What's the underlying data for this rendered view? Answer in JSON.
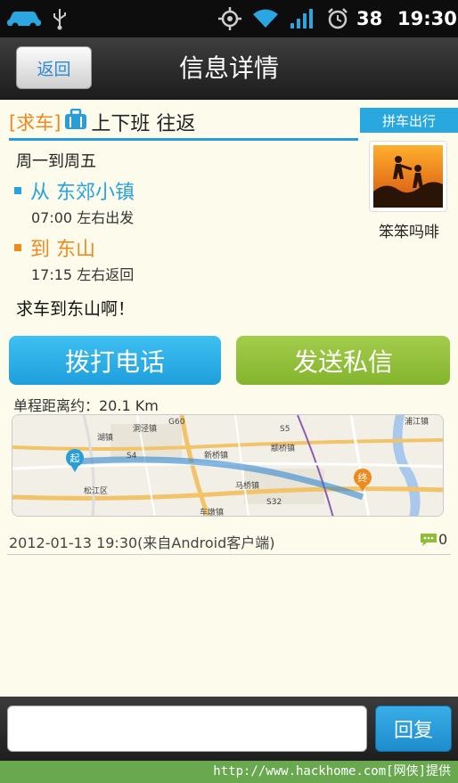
{
  "status_bar": {
    "battery": "38",
    "time": "19:30"
  },
  "header": {
    "back_label": "返回",
    "title": "信息详情"
  },
  "post": {
    "tag": "[求车]",
    "route_type": "上下班 往返",
    "badge": "拼车出行",
    "days": "周一到周五",
    "from_label": "从 东郊小镇",
    "from_time": "07:00 左右出发",
    "to_label": "到 东山",
    "to_time": "17:15 左右返回",
    "message": "求车到东山啊！",
    "username": "笨笨吗啡"
  },
  "actions": {
    "call": "拨打电话",
    "message": "发送私信"
  },
  "distance": "单程距离约：20.1 Km",
  "map": {
    "labels": [
      "洞泾镇",
      "湖镇",
      "新桥镇",
      "颛桥镇",
      "浦江镇",
      "马桥镇",
      "松江区",
      "车墩镇",
      "S5",
      "S32",
      "S4",
      "G60"
    ],
    "start_marker": "起",
    "end_marker": "终"
  },
  "footer": {
    "date": "2012-01-13 19:30(来自Android客户端)",
    "comment_count": "0"
  },
  "reply": {
    "placeholder": "",
    "button": "回复"
  },
  "watermark": "http://www.hackhome.com[网侠]提供",
  "colors": {
    "accent_blue": "#29a8e0",
    "accent_orange": "#f0871e",
    "accent_green": "#8ebd36"
  }
}
